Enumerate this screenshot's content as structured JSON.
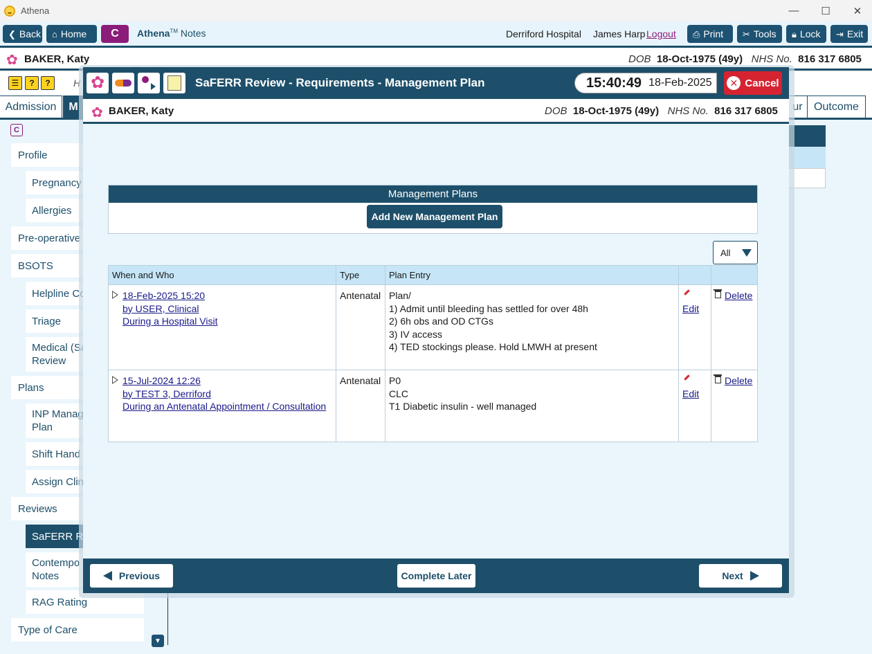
{
  "window": {
    "title": "Athena",
    "controls": [
      "—",
      "☐",
      "✕"
    ]
  },
  "toolbar": {
    "back": "Back",
    "home": "Home",
    "c_badge": "C",
    "brand": "Athena",
    "brand_tm": "TM",
    "brand_suffix": "Notes",
    "hospital": "Derriford Hospital",
    "user": "James Harp",
    "logout": "Logout",
    "print": "Print",
    "tools": "Tools",
    "lock": "Lock",
    "exit": "Exit"
  },
  "patient": {
    "name": "BAKER, Katy",
    "dob_label": "DOB",
    "dob": "18-Oct-1975 (49y)",
    "nhs_label": "NHS No.",
    "nhs": "816 317 6805"
  },
  "background": {
    "h_letter": "H",
    "tabs": {
      "admission": "Admission",
      "m": "M",
      "ur": "ur",
      "outcome": "Outcome"
    },
    "sidebar": {
      "c_icon": "C",
      "items": [
        {
          "label": "Profile"
        },
        {
          "label": "Pregnancy"
        },
        {
          "label": "Allergies"
        },
        {
          "label": "Pre-operative"
        },
        {
          "label": "BSOTS"
        },
        {
          "label": "Helpline Co"
        },
        {
          "label": "Triage"
        },
        {
          "label": "Medical (Sa",
          "label2": "Review"
        },
        {
          "label": "Plans"
        },
        {
          "label": "INP Manag",
          "label2": "Plan"
        },
        {
          "label": "Shift Hand"
        },
        {
          "label": "Assign Clin"
        },
        {
          "label": "Reviews"
        },
        {
          "label": "SaFERR Rev"
        },
        {
          "label": "Contempo",
          "label2": "Notes"
        },
        {
          "label": "RAG Rating"
        },
        {
          "label": "Type of Care"
        }
      ]
    }
  },
  "modal": {
    "title": "SaFERR Review - Requirements - Management Plan",
    "time": "15:40:49",
    "date": "18-Feb-2025",
    "cancel": "Cancel",
    "panel_title": "Management Plans",
    "add_button": "Add New Management Plan",
    "filter_value": "All",
    "columns": {
      "when": "When and Who",
      "type": "Type",
      "entry": "Plan Entry"
    },
    "rows": [
      {
        "when": "18-Feb-2025 15:20",
        "who": "by USER, Clinical",
        "context": "During a Hospital Visit",
        "type": "Antenatal",
        "lines": [
          "Plan/",
          "1) Admit until bleeding has settled for over 48h",
          "2) 6h obs and OD CTGs",
          "3) IV access",
          "4) TED stockings please. Hold LMWH at present"
        ],
        "edit": "Edit",
        "delete": "Delete"
      },
      {
        "when": "15-Jul-2024 12:26",
        "who": "by TEST 3, Derriford",
        "context": "During an Antenatal Appointment / Consultation",
        "type": "Antenatal",
        "lines": [
          "P0",
          "CLC",
          "T1 Diabetic insulin - well managed"
        ],
        "edit": "Edit",
        "delete": "Delete"
      }
    ],
    "footer": {
      "previous": "Previous",
      "complete_later": "Complete Later",
      "next": "Next"
    }
  }
}
